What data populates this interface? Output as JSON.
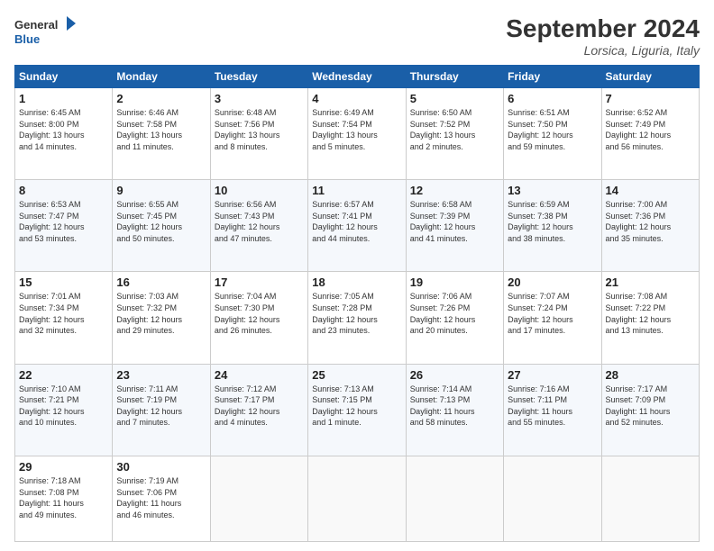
{
  "header": {
    "logo_line1": "General",
    "logo_line2": "Blue",
    "month_title": "September 2024",
    "subtitle": "Lorsica, Liguria, Italy"
  },
  "days_of_week": [
    "Sunday",
    "Monday",
    "Tuesday",
    "Wednesday",
    "Thursday",
    "Friday",
    "Saturday"
  ],
  "weeks": [
    [
      {
        "day": "1",
        "info": "Sunrise: 6:45 AM\nSunset: 8:00 PM\nDaylight: 13 hours\nand 14 minutes."
      },
      {
        "day": "2",
        "info": "Sunrise: 6:46 AM\nSunset: 7:58 PM\nDaylight: 13 hours\nand 11 minutes."
      },
      {
        "day": "3",
        "info": "Sunrise: 6:48 AM\nSunset: 7:56 PM\nDaylight: 13 hours\nand 8 minutes."
      },
      {
        "day": "4",
        "info": "Sunrise: 6:49 AM\nSunset: 7:54 PM\nDaylight: 13 hours\nand 5 minutes."
      },
      {
        "day": "5",
        "info": "Sunrise: 6:50 AM\nSunset: 7:52 PM\nDaylight: 13 hours\nand 2 minutes."
      },
      {
        "day": "6",
        "info": "Sunrise: 6:51 AM\nSunset: 7:50 PM\nDaylight: 12 hours\nand 59 minutes."
      },
      {
        "day": "7",
        "info": "Sunrise: 6:52 AM\nSunset: 7:49 PM\nDaylight: 12 hours\nand 56 minutes."
      }
    ],
    [
      {
        "day": "8",
        "info": "Sunrise: 6:53 AM\nSunset: 7:47 PM\nDaylight: 12 hours\nand 53 minutes."
      },
      {
        "day": "9",
        "info": "Sunrise: 6:55 AM\nSunset: 7:45 PM\nDaylight: 12 hours\nand 50 minutes."
      },
      {
        "day": "10",
        "info": "Sunrise: 6:56 AM\nSunset: 7:43 PM\nDaylight: 12 hours\nand 47 minutes."
      },
      {
        "day": "11",
        "info": "Sunrise: 6:57 AM\nSunset: 7:41 PM\nDaylight: 12 hours\nand 44 minutes."
      },
      {
        "day": "12",
        "info": "Sunrise: 6:58 AM\nSunset: 7:39 PM\nDaylight: 12 hours\nand 41 minutes."
      },
      {
        "day": "13",
        "info": "Sunrise: 6:59 AM\nSunset: 7:38 PM\nDaylight: 12 hours\nand 38 minutes."
      },
      {
        "day": "14",
        "info": "Sunrise: 7:00 AM\nSunset: 7:36 PM\nDaylight: 12 hours\nand 35 minutes."
      }
    ],
    [
      {
        "day": "15",
        "info": "Sunrise: 7:01 AM\nSunset: 7:34 PM\nDaylight: 12 hours\nand 32 minutes."
      },
      {
        "day": "16",
        "info": "Sunrise: 7:03 AM\nSunset: 7:32 PM\nDaylight: 12 hours\nand 29 minutes."
      },
      {
        "day": "17",
        "info": "Sunrise: 7:04 AM\nSunset: 7:30 PM\nDaylight: 12 hours\nand 26 minutes."
      },
      {
        "day": "18",
        "info": "Sunrise: 7:05 AM\nSunset: 7:28 PM\nDaylight: 12 hours\nand 23 minutes."
      },
      {
        "day": "19",
        "info": "Sunrise: 7:06 AM\nSunset: 7:26 PM\nDaylight: 12 hours\nand 20 minutes."
      },
      {
        "day": "20",
        "info": "Sunrise: 7:07 AM\nSunset: 7:24 PM\nDaylight: 12 hours\nand 17 minutes."
      },
      {
        "day": "21",
        "info": "Sunrise: 7:08 AM\nSunset: 7:22 PM\nDaylight: 12 hours\nand 13 minutes."
      }
    ],
    [
      {
        "day": "22",
        "info": "Sunrise: 7:10 AM\nSunset: 7:21 PM\nDaylight: 12 hours\nand 10 minutes."
      },
      {
        "day": "23",
        "info": "Sunrise: 7:11 AM\nSunset: 7:19 PM\nDaylight: 12 hours\nand 7 minutes."
      },
      {
        "day": "24",
        "info": "Sunrise: 7:12 AM\nSunset: 7:17 PM\nDaylight: 12 hours\nand 4 minutes."
      },
      {
        "day": "25",
        "info": "Sunrise: 7:13 AM\nSunset: 7:15 PM\nDaylight: 12 hours\nand 1 minute."
      },
      {
        "day": "26",
        "info": "Sunrise: 7:14 AM\nSunset: 7:13 PM\nDaylight: 11 hours\nand 58 minutes."
      },
      {
        "day": "27",
        "info": "Sunrise: 7:16 AM\nSunset: 7:11 PM\nDaylight: 11 hours\nand 55 minutes."
      },
      {
        "day": "28",
        "info": "Sunrise: 7:17 AM\nSunset: 7:09 PM\nDaylight: 11 hours\nand 52 minutes."
      }
    ],
    [
      {
        "day": "29",
        "info": "Sunrise: 7:18 AM\nSunset: 7:08 PM\nDaylight: 11 hours\nand 49 minutes."
      },
      {
        "day": "30",
        "info": "Sunrise: 7:19 AM\nSunset: 7:06 PM\nDaylight: 11 hours\nand 46 minutes."
      },
      {
        "day": "",
        "info": ""
      },
      {
        "day": "",
        "info": ""
      },
      {
        "day": "",
        "info": ""
      },
      {
        "day": "",
        "info": ""
      },
      {
        "day": "",
        "info": ""
      }
    ]
  ]
}
